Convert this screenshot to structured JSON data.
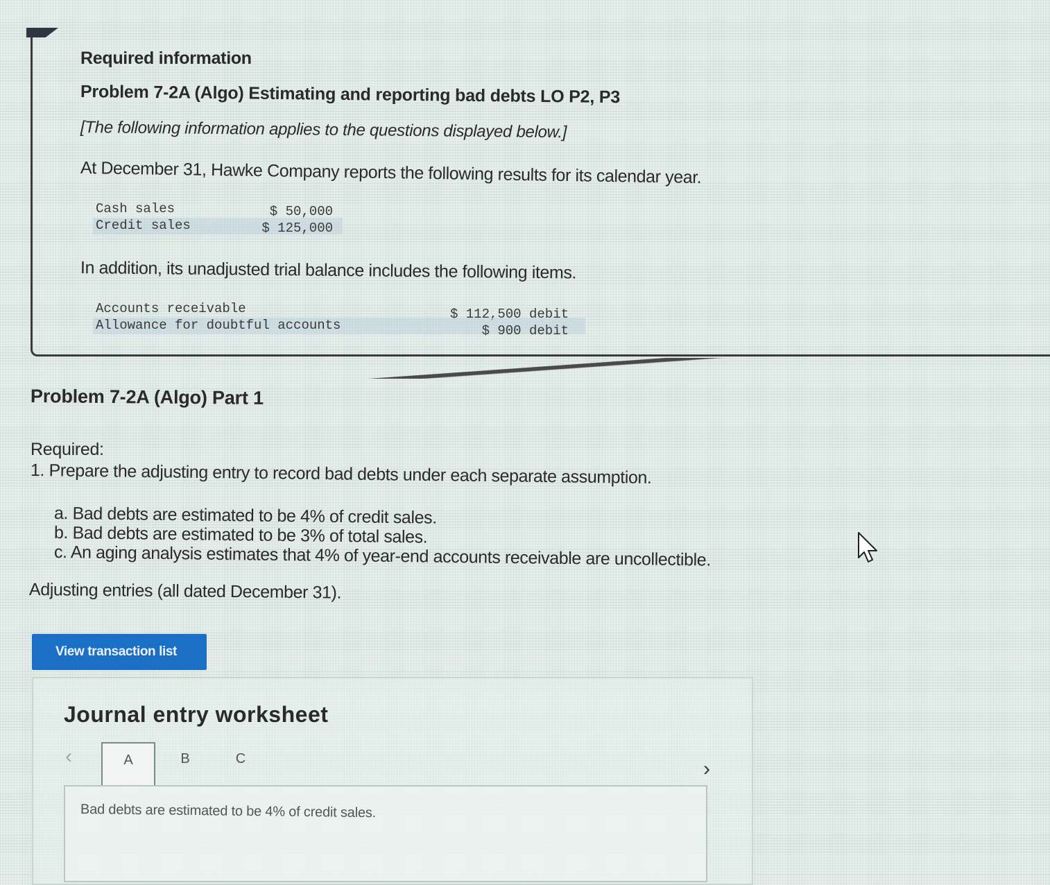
{
  "info": {
    "heading": "Required information",
    "problem_title": "Problem 7-2A (Algo) Estimating and reporting bad debts LO P2, P3",
    "note": "[The following information applies to the questions displayed below.]",
    "intro": "At December 31, Hawke Company reports the following results for its calendar year.",
    "sales": [
      {
        "label": "Cash sales",
        "value": "$ 50,000"
      },
      {
        "label": "Credit sales",
        "value": "$ 125,000"
      }
    ],
    "addition": "In addition, its unadjusted trial balance includes the following items.",
    "trial_balance": [
      {
        "label": "Accounts receivable",
        "value": "$ 112,500 debit"
      },
      {
        "label": "Allowance for doubtful accounts",
        "value": "$ 900 debit"
      }
    ]
  },
  "part": {
    "title": "Problem 7-2A (Algo) Part 1",
    "required_label": "Required:",
    "step1": "1. Prepare the adjusting entry to record bad debts under each separate assumption.",
    "options": [
      "a. Bad debts are estimated to be 4% of credit sales.",
      "b. Bad debts are estimated to be 3% of total sales.",
      "c. An aging analysis estimates that 4% of year-end accounts receivable are uncollectible."
    ],
    "adjusting_note": "Adjusting entries (all dated December 31)."
  },
  "view_button_label": "View transaction list",
  "worksheet": {
    "title": "Journal entry worksheet",
    "prev_icon": "chevron-left-icon",
    "next_icon": "chevron-right-icon",
    "tabs": [
      "A",
      "B",
      "C"
    ],
    "selected_tab": "A",
    "entry_description": "Bad debts are estimated to be 4% of credit sales."
  },
  "colors": {
    "button_blue": "#1b6fc4",
    "text": "#2a2a2a"
  }
}
